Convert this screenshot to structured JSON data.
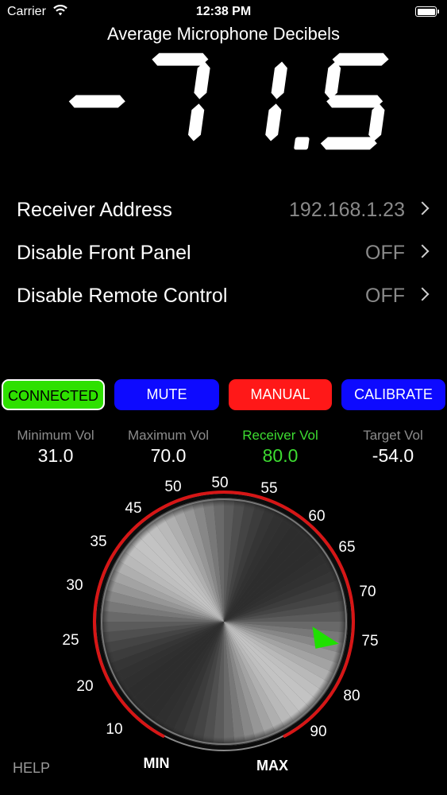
{
  "status_bar": {
    "carrier": "Carrier",
    "time": "12:38 PM",
    "wifi_icon": "wifi-icon",
    "battery_icon": "battery-icon"
  },
  "meter": {
    "title": "Average Microphone Decibels",
    "reading": "-71.5"
  },
  "settings": [
    {
      "label": "Receiver Address",
      "value": "192.168.1.23"
    },
    {
      "label": "Disable Front Panel",
      "value": "OFF"
    },
    {
      "label": "Disable Remote Control",
      "value": "OFF"
    }
  ],
  "buttons": {
    "connected": "CONNECTED",
    "mute": "MUTE",
    "manual": "MANUAL",
    "calibrate": "CALIBRATE"
  },
  "stats": [
    {
      "label": "Minimum Vol",
      "value": "31.0"
    },
    {
      "label": "Maximum Vol",
      "value": "70.0"
    },
    {
      "label": "Receiver Vol",
      "value": "80.0"
    },
    {
      "label": "Target Vol",
      "value": "-54.0"
    }
  ],
  "dial": {
    "scale_labels": [
      "10",
      "20",
      "25",
      "30",
      "35",
      "45",
      "50",
      "50",
      "55",
      "60",
      "65",
      "70",
      "75",
      "80",
      "90"
    ],
    "min_label": "MIN",
    "max_label": "MAX",
    "pointer_icon": "green-triangle-pointer-icon"
  },
  "help": "HELP",
  "colors": {
    "connected_green": "#2ee000",
    "button_blue": "#0d0aff",
    "manual_red": "#ff1818",
    "arc_red": "#d61616",
    "receiver_green": "#3ddc31",
    "pointer_green": "#1fe000",
    "dim_text": "#8a8a8a"
  }
}
